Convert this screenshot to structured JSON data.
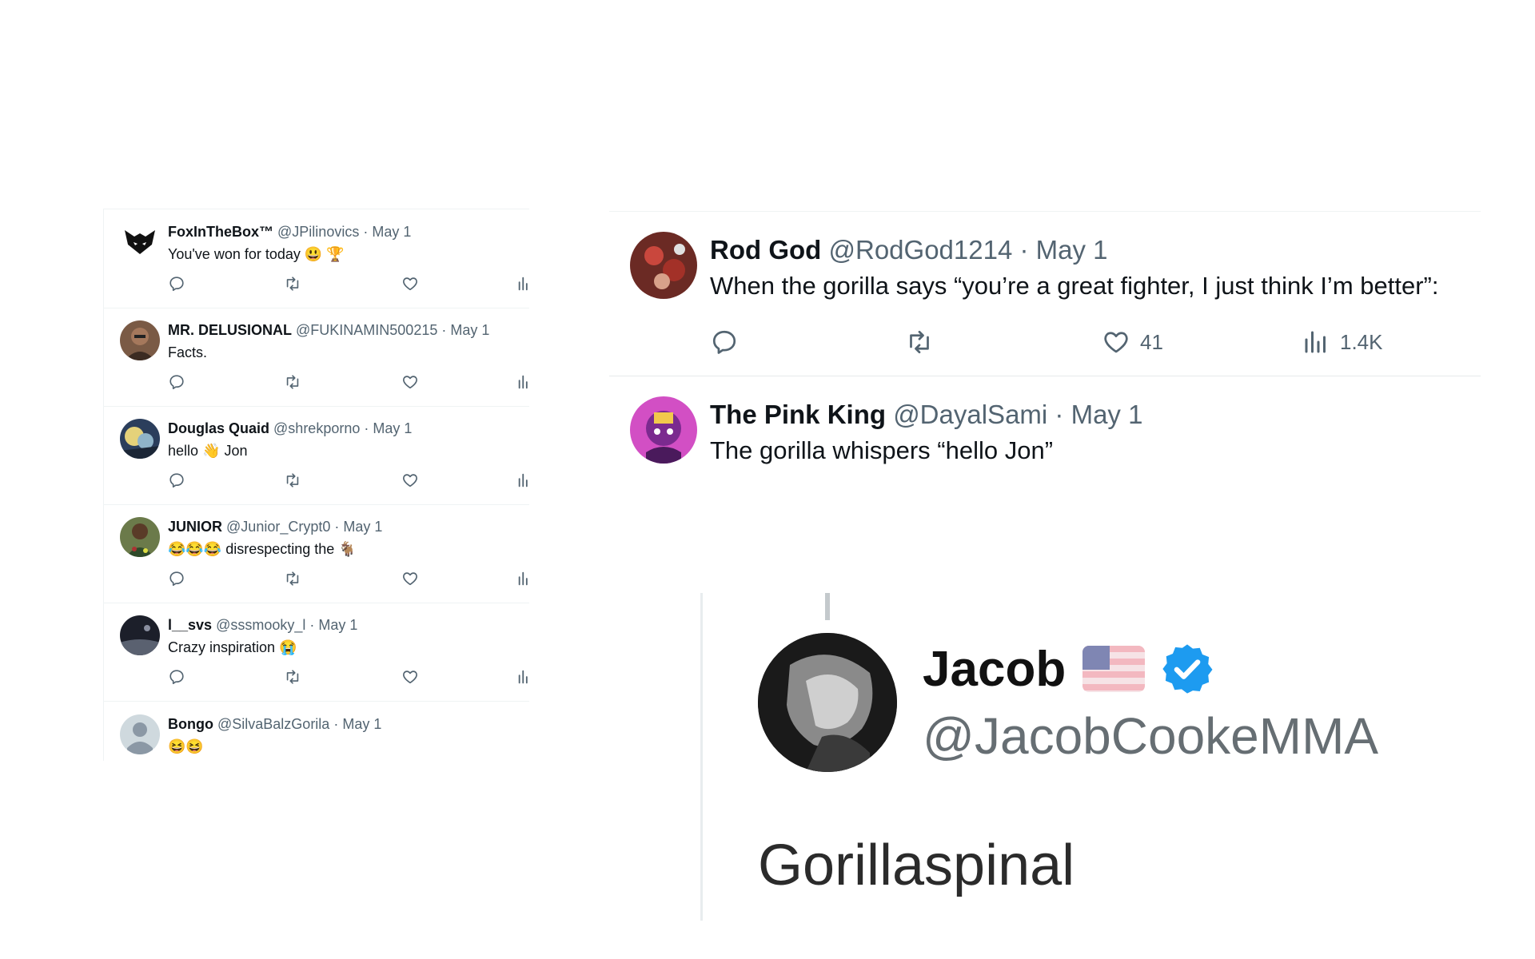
{
  "left_replies": [
    {
      "name": "FoxInTheBox™",
      "handle": "@JPilinovics",
      "date": "May 1",
      "text": "You've won for today 😃 🏆"
    },
    {
      "name": "MR. DELUSIONAL",
      "handle": "@FUKINAMIN500215",
      "date": "May 1",
      "text": "Facts."
    },
    {
      "name": "Douglas Quaid",
      "handle": "@shrekporno",
      "date": "May 1",
      "text": "hello 👋 Jon"
    },
    {
      "name": "JUNIOR",
      "handle": "@Junior_Crypt0",
      "date": "May 1",
      "text": "😂😂😂 disrespecting the 🐐"
    },
    {
      "name": "l__svs",
      "handle": "@sssmooky_l",
      "date": "May 1",
      "text": "Crazy inspiration 😭"
    },
    {
      "name": "Bongo",
      "handle": "@SilvaBalzGorila",
      "date": "May 1",
      "text": "😆😆"
    }
  ],
  "main_tweets": [
    {
      "name": "Rod God",
      "handle": "@RodGod1214",
      "date": "May 1",
      "text": "When the gorilla says “you’re a great fighter, I just think I’m better”:",
      "likes": "41",
      "views": "1.4K"
    },
    {
      "name": "The Pink King",
      "handle": "@DayalSami",
      "date": "May 1",
      "text": "The gorilla whispers “hello Jon”"
    }
  ],
  "quoted": {
    "name": "Jacob",
    "handle": "@JacobCookeMMA",
    "text": "Gorillaspinal"
  },
  "colors": {
    "text_primary": "#0f1419",
    "text_secondary": "#536471",
    "border": "#eff3f4",
    "verified": "#1d9bf0"
  },
  "icons": [
    "reply-icon",
    "retweet-icon",
    "like-icon",
    "views-icon",
    "verified-badge-icon",
    "us-flag-icon"
  ]
}
